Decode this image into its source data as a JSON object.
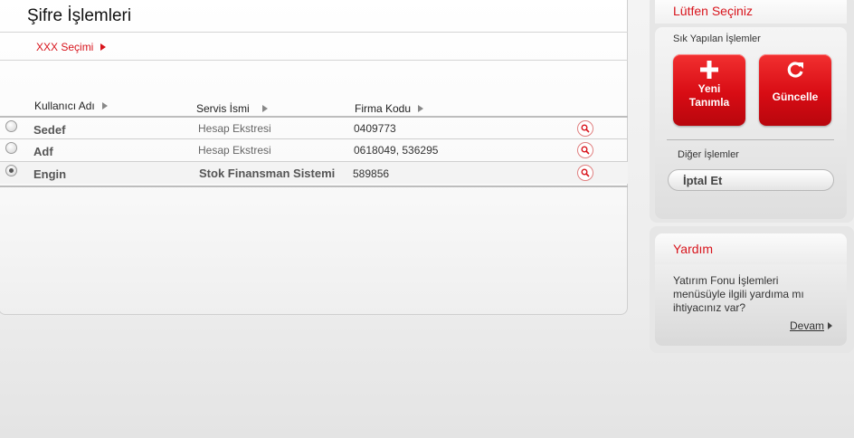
{
  "page": {
    "title": "Şifre İşlemleri"
  },
  "selection_link": {
    "label": "XXX Seçimi"
  },
  "table": {
    "headers": {
      "user": "Kullanıcı Adı",
      "service": "Servis İsmi",
      "company": "Firma Kodu"
    },
    "rows": [
      {
        "user": "Sedef",
        "service": "Hesap Ekstresi",
        "company": "0409773",
        "selected": false
      },
      {
        "user": "Adf",
        "service": "Hesap Ekstresi",
        "company": "0618049, 536295",
        "selected": false
      },
      {
        "user": "Engin",
        "service": "Stok Finansman Sistemi",
        "company": "589856",
        "selected": true
      }
    ]
  },
  "sidebar": {
    "title": "Lütfen Seçiniz",
    "frequent_label": "Sık Yapılan İşlemler",
    "buttons": {
      "new_line1": "Yeni",
      "new_line2": "Tanımla",
      "update": "Güncelle"
    },
    "other_label": "Diğer İşlemler",
    "cancel_label": "İptal Et"
  },
  "help": {
    "title": "Yardım",
    "text": "Yatırım Fonu İşlemleri menüsüyle ilgili yardıma mı ihtiyacınız var?",
    "continue_label": "Devam"
  },
  "colors": {
    "accent": "#d8141c",
    "panel_bg": "#e6e6e6"
  },
  "icons": {
    "add": "plus-icon",
    "refresh": "refresh-icon",
    "search": "magnifier-icon"
  }
}
